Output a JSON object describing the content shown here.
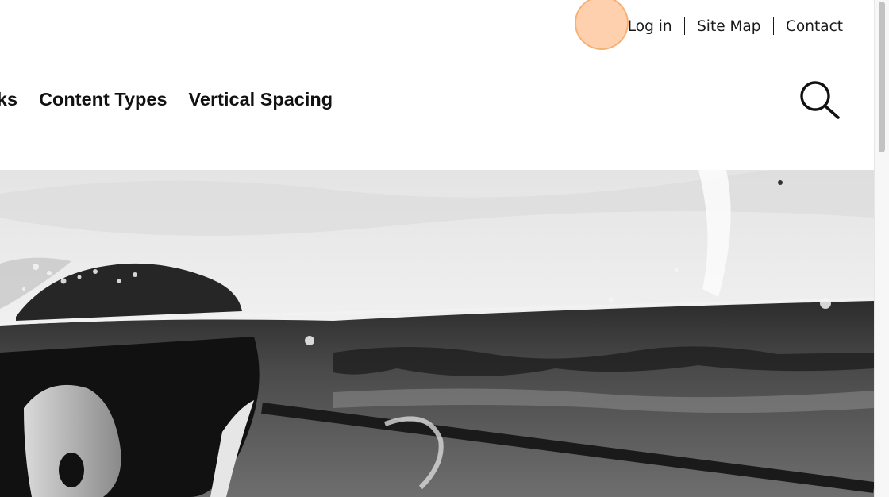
{
  "utility_nav": {
    "login": "Log in",
    "site_map": "Site Map",
    "contact": "Contact"
  },
  "main_nav": {
    "items": [
      "Blocks",
      "Content Types",
      "Vertical Spacing"
    ]
  },
  "search": {
    "icon": "search-icon"
  },
  "hero": {
    "icon": "hero-image"
  }
}
